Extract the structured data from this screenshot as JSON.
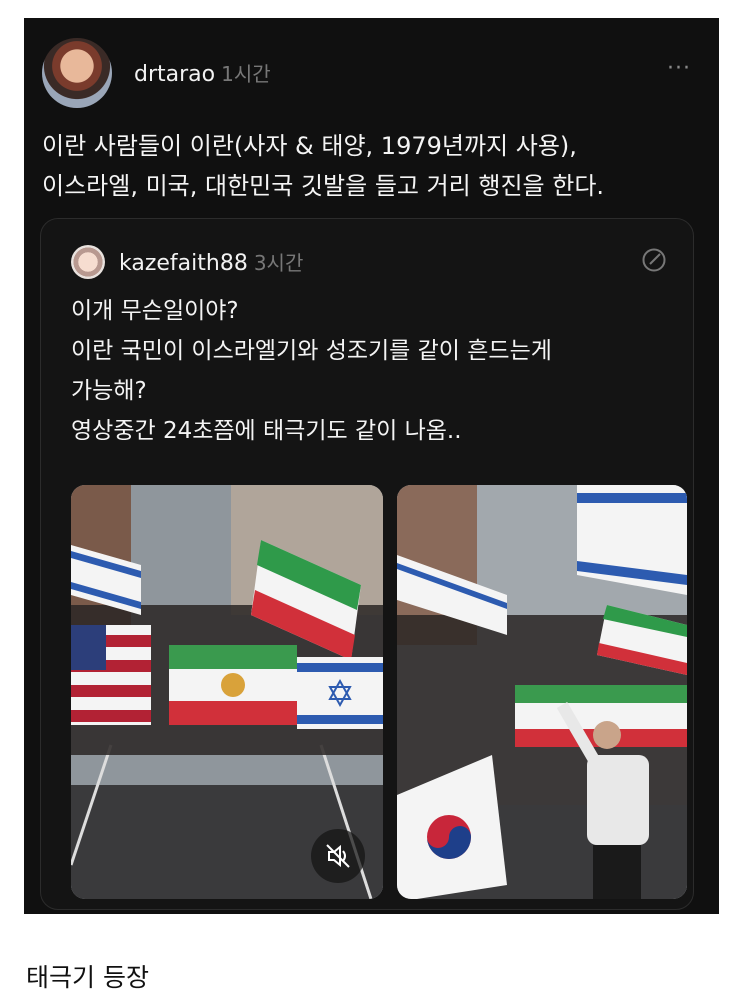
{
  "post": {
    "username": "drtarao",
    "time": "1시간",
    "more": "···",
    "lines": [
      "이란 사람들이 이란(사자 & 태양, 1979년까지 사용),",
      "이스라엘, 미국, 대한민국 깃발을 들고 거리 행진을 한다."
    ]
  },
  "quoted": {
    "username": "kazefaith88",
    "time": "3시간",
    "lines": [
      "이개 무슨일이야?",
      "이란 국민이 이스라엘기와 성조기를 같이 흔드는게",
      "가능해?",
      "영상중간 24초쯤에 태극기도 같이 나옴.."
    ],
    "media": [
      "video-frame-iran-israel-usa-flags",
      "video-frame-korea-flag"
    ]
  },
  "caption": "태극기 등장",
  "colors": {
    "card": "#101010",
    "text": "#f4f4f4",
    "muted": "#777777"
  }
}
